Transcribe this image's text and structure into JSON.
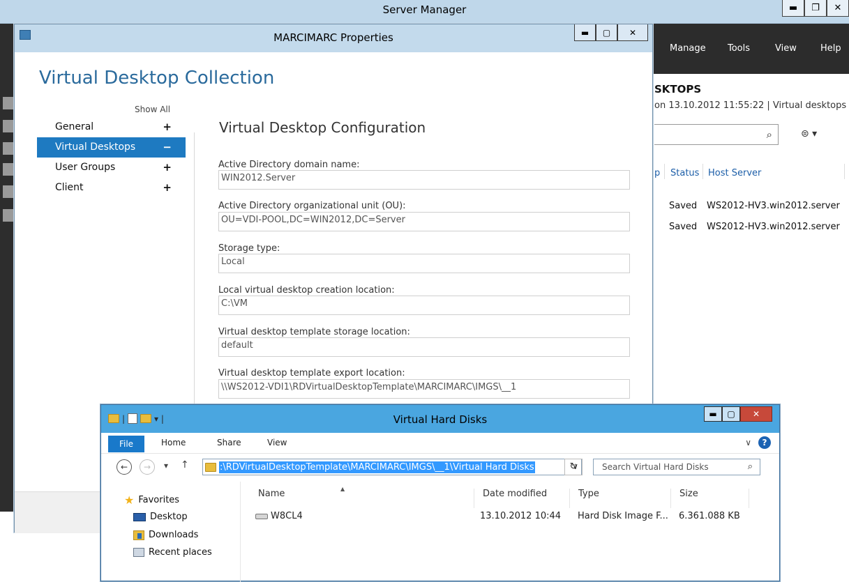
{
  "server_manager": {
    "title": "Server Manager",
    "menu": [
      "Manage",
      "Tools",
      "View",
      "Help"
    ],
    "heading": "SKTOPS",
    "subheading": "on 13.10.2012 11:55:22 | Virtual desktops |...",
    "columns": [
      "p",
      "Status",
      "Host Server"
    ],
    "rows": [
      {
        "status": "Saved",
        "host": "WS2012-HV3.win2012.server"
      },
      {
        "status": "Saved",
        "host": "WS2012-HV3.win2012.server"
      }
    ]
  },
  "properties": {
    "title": "MARCIMARC Properties",
    "heading": "Virtual Desktop Collection",
    "show_all": "Show All",
    "nav": [
      {
        "label": "General",
        "sign": "+"
      },
      {
        "label": "Virtual Desktops",
        "sign": "−"
      },
      {
        "label": "User Groups",
        "sign": "+"
      },
      {
        "label": "Client",
        "sign": "+"
      }
    ],
    "section_title": "Virtual Desktop Configuration",
    "fields": [
      {
        "label": "Active Directory domain name:",
        "value": "WIN2012.Server"
      },
      {
        "label": "Active Directory organizational unit (OU):",
        "value": "OU=VDI-POOL,DC=WIN2012,DC=Server"
      },
      {
        "label": "Storage type:",
        "value": "Local"
      },
      {
        "label": "Local virtual desktop creation location:",
        "value": "C:\\VM"
      },
      {
        "label": "Virtual desktop template storage location:",
        "value": "default"
      },
      {
        "label": "Virtual desktop template export location:",
        "value": "\\\\WS2012-VDI1\\RDVirtualDesktopTemplate\\MARCIMARC\\IMGS\\__1"
      }
    ]
  },
  "explorer": {
    "title": "Virtual Hard Disks",
    "ribbon_tabs": [
      "File",
      "Home",
      "Share",
      "View"
    ],
    "address": ":\\RDVirtualDesktopTemplate\\MARCIMARC\\IMGS\\__1\\Virtual Hard Disks",
    "search_placeholder": "Search Virtual Hard Disks",
    "favorites": {
      "header": "Favorites",
      "items": [
        "Desktop",
        "Downloads",
        "Recent places"
      ]
    },
    "columns": [
      "Name",
      "Date modified",
      "Type",
      "Size"
    ],
    "files": [
      {
        "name": "W8CL4",
        "date": "13.10.2012 10:44",
        "type": "Hard Disk Image F...",
        "size": "6.361.088 KB"
      }
    ]
  }
}
